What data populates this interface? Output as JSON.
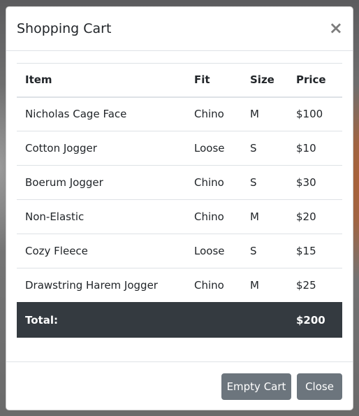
{
  "modal": {
    "title": "Shopping Cart",
    "close_glyph": "×"
  },
  "table": {
    "headers": [
      "Item",
      "Fit",
      "Size",
      "Price"
    ],
    "rows": [
      {
        "item": "Nicholas Cage Face",
        "fit": "Chino",
        "size": "M",
        "price": "$100"
      },
      {
        "item": "Cotton Jogger",
        "fit": "Loose",
        "size": "S",
        "price": "$10"
      },
      {
        "item": "Boerum Jogger",
        "fit": "Chino",
        "size": "S",
        "price": "$30"
      },
      {
        "item": "Non-Elastic",
        "fit": "Chino",
        "size": "M",
        "price": "$20"
      },
      {
        "item": "Cozy Fleece",
        "fit": "Loose",
        "size": "S",
        "price": "$15"
      },
      {
        "item": "Drawstring Harem Jogger",
        "fit": "Chino",
        "size": "M",
        "price": "$25"
      }
    ],
    "total_label": "Total:",
    "total_value": "$200"
  },
  "footer": {
    "empty_cart_label": "Empty Cart",
    "close_label": "Close"
  },
  "colors": {
    "total_row_bg": "#343a40",
    "button_bg": "#6c757d"
  }
}
